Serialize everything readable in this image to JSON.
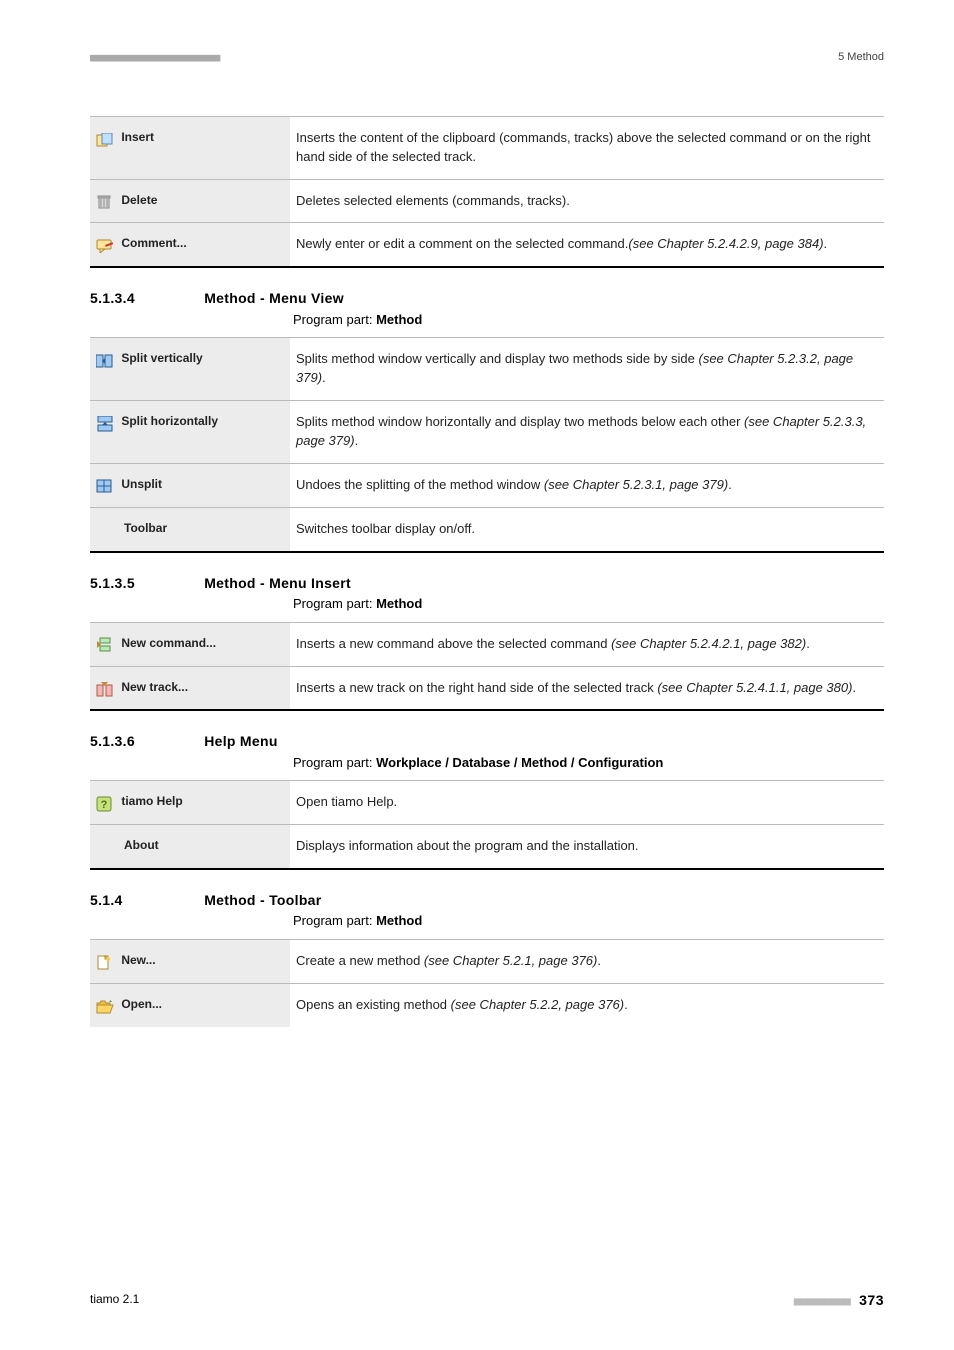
{
  "header": {
    "dots": "■■■■■■■■■■■■■■■■■■■■■■■",
    "chapter": "5 Method"
  },
  "table1": {
    "rows": [
      {
        "icon": "clipboard-icon",
        "label": "Insert",
        "desc_pre": "Inserts the content of the clipboard (commands, tracks) above the selected command or on the right hand side of the selected track.",
        "ital": ""
      },
      {
        "icon": "trash-icon",
        "label": "Delete",
        "desc_pre": "Deletes selected elements (commands, tracks).",
        "ital": ""
      },
      {
        "icon": "comment-icon",
        "label": "Comment...",
        "desc_pre": "Newly enter or edit a comment on the selected command.",
        "ital": "(see Chapter 5.2.4.2.9, page 384)",
        "desc_post": "."
      }
    ]
  },
  "sec5134": {
    "num": "5.1.3.4",
    "title": "Method - Menu View"
  },
  "progpart_method_pre": "Program part: ",
  "progpart_method": "Method",
  "table2": {
    "rows": [
      {
        "icon": "split-v-icon",
        "label": "Split vertically",
        "desc_pre": "Splits method window vertically and display two methods side by side ",
        "ital": "(see Chapter 5.2.3.2, page 379)",
        "desc_post": "."
      },
      {
        "icon": "split-h-icon",
        "label": "Split horizontally",
        "desc_pre": "Splits method window horizontally and display two methods below each other ",
        "ital": "(see Chapter 5.2.3.3, page 379)",
        "desc_post": "."
      },
      {
        "icon": "unsplit-icon",
        "label": "Unsplit",
        "desc_pre": "Undoes the splitting of the method window ",
        "ital": "(see Chapter 5.2.3.1, page 379)",
        "desc_post": "."
      },
      {
        "icon": "",
        "label": "Toolbar",
        "desc_pre": "Switches toolbar display on/off.",
        "ital": ""
      }
    ]
  },
  "sec5135": {
    "num": "5.1.3.5",
    "title": "Method - Menu Insert"
  },
  "table3": {
    "rows": [
      {
        "icon": "new-cmd-icon",
        "label": "New command...",
        "desc_pre": "Inserts a new command above the selected command ",
        "ital": "(see Chapter 5.2.4.2.1, page 382)",
        "desc_post": "."
      },
      {
        "icon": "new-track-icon",
        "label": "New track...",
        "desc_pre": "Inserts a new track on the right hand side of the selected track ",
        "ital": "(see Chapter 5.2.4.1.1, page 380)",
        "desc_post": "."
      }
    ]
  },
  "sec5136": {
    "num": "5.1.3.6",
    "title": "Help Menu"
  },
  "progpart_help_pre": "Program part: ",
  "progpart_help": "Workplace / Database / Method / Configuration",
  "table4": {
    "rows": [
      {
        "icon": "help-icon",
        "label": "tiamo Help",
        "desc_pre": "Open tiamo Help.",
        "ital": ""
      },
      {
        "icon": "",
        "label": "About",
        "desc_pre": "Displays information about the program and the installation.",
        "ital": ""
      }
    ]
  },
  "sec514": {
    "num": "5.1.4",
    "title": "Method - Toolbar"
  },
  "table5": {
    "rows": [
      {
        "icon": "new-icon",
        "label": "New...",
        "desc_pre": "Create a new method ",
        "ital": "(see Chapter 5.2.1, page 376)",
        "desc_post": "."
      },
      {
        "icon": "open-icon",
        "label": "Open...",
        "desc_pre": "Opens an existing method ",
        "ital": "(see Chapter 5.2.2, page 376)",
        "desc_post": "."
      }
    ]
  },
  "footer": {
    "product": "tiamo 2.1",
    "dots": "■■■■■■■■■",
    "page": "373"
  }
}
